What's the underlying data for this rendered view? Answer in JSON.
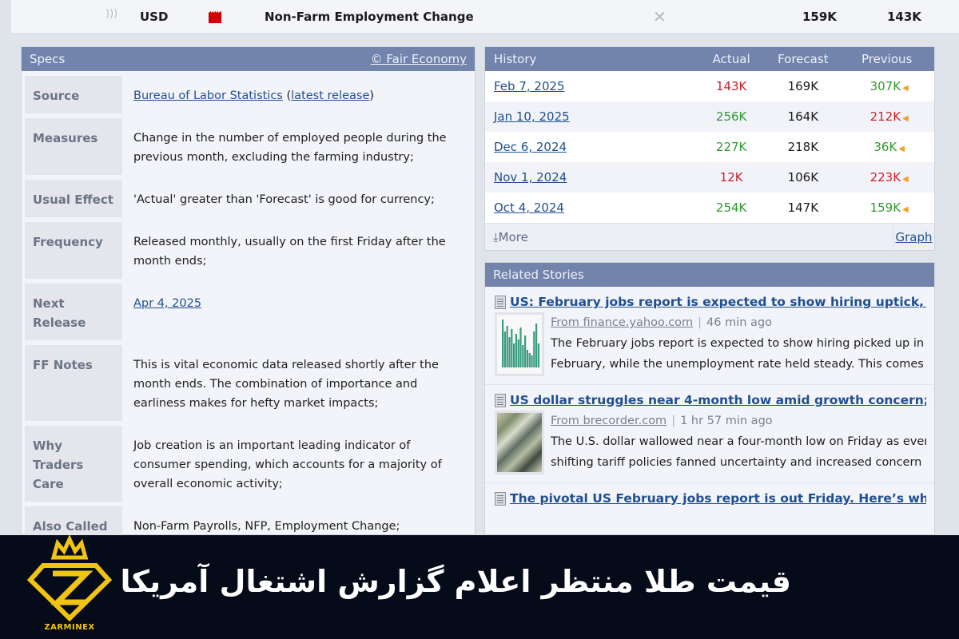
{
  "event": {
    "currency": "USD",
    "title": "Non-Farm Employment Change",
    "actual": "159K",
    "forecast": "143K",
    "impact_color": "#d40000"
  },
  "specs": {
    "header": "Specs",
    "credit_link": "© Fair Economy",
    "rows": [
      {
        "label": "Source",
        "link1": "Bureau of Labor Statistics",
        "open": " (",
        "link2": "latest release",
        "close": ")"
      },
      {
        "label": "Measures",
        "value": "Change in the number of employed people during the previous month, excluding the farming industry;"
      },
      {
        "label": "Usual Effect",
        "value": "'Actual' greater than 'Forecast' is good for currency;"
      },
      {
        "label": "Frequency",
        "value": "Released monthly, usually on the first Friday after the month ends;"
      },
      {
        "label": "Next Release",
        "link": "Apr 4, 2025"
      },
      {
        "label": "FF Notes",
        "value": "This is vital economic data released shortly after the month ends. The combination of importance and earliness makes for hefty market impacts;"
      },
      {
        "label": "Why Traders Care",
        "value": "Job creation is an important leading indicator of consumer spending, which accounts for a majority of overall economic activity;"
      },
      {
        "label": "Also Called",
        "value": "Non-Farm Payrolls, NFP, Employment Change;"
      }
    ]
  },
  "history": {
    "header": "History",
    "columns": [
      "Actual",
      "Forecast",
      "Previous"
    ],
    "rows": [
      {
        "date": "Feb 7, 2025",
        "actual": "143K",
        "actual_status": "neg",
        "forecast": "169K",
        "previous": "307K",
        "previous_status": "pos"
      },
      {
        "date": "Jan 10, 2025",
        "actual": "256K",
        "actual_status": "pos",
        "forecast": "164K",
        "previous": "212K",
        "previous_status": "neg"
      },
      {
        "date": "Dec 6, 2024",
        "actual": "227K",
        "actual_status": "pos",
        "forecast": "218K",
        "previous": "36K",
        "previous_status": "pos"
      },
      {
        "date": "Nov 1, 2024",
        "actual": "12K",
        "actual_status": "neg",
        "forecast": "106K",
        "previous": "223K",
        "previous_status": "neg"
      },
      {
        "date": "Oct 4, 2024",
        "actual": "254K",
        "actual_status": "pos",
        "forecast": "147K",
        "previous": "159K",
        "previous_status": "pos"
      }
    ],
    "more_label": "More",
    "graph_label": "Graph"
  },
  "stories": {
    "header": "Related Stories",
    "items": [
      {
        "title": "US: February jobs report is expected to show hiring uptick, unemployment",
        "source": "From finance.yahoo.com",
        "time": "46 min ago",
        "line1": "The February jobs report is expected to show hiring picked up in",
        "line2": "February, while the unemployment rate held steady. This comes at",
        "thumb": "chart"
      },
      {
        "title": "US dollar struggles near 4-month low amid growth concern; US jobs data",
        "source": "From brecorder.com",
        "time": "1 hr 57 min ago",
        "line1": "The U.S. dollar wallowed near a four-month low on Friday as ever-",
        "line2": "shifting tariff policies fanned uncertainty and increased concern",
        "thumb": "money"
      },
      {
        "title": "The pivotal US February jobs report is out Friday. Here’s what to expect"
      }
    ]
  },
  "banner": {
    "title": "قیمت طلا منتظر اعلام گزارش اشتغال آمریکا",
    "brand": "ZARMINEX",
    "brand_color": "#f2c412",
    "bg_color": "#050b18"
  }
}
